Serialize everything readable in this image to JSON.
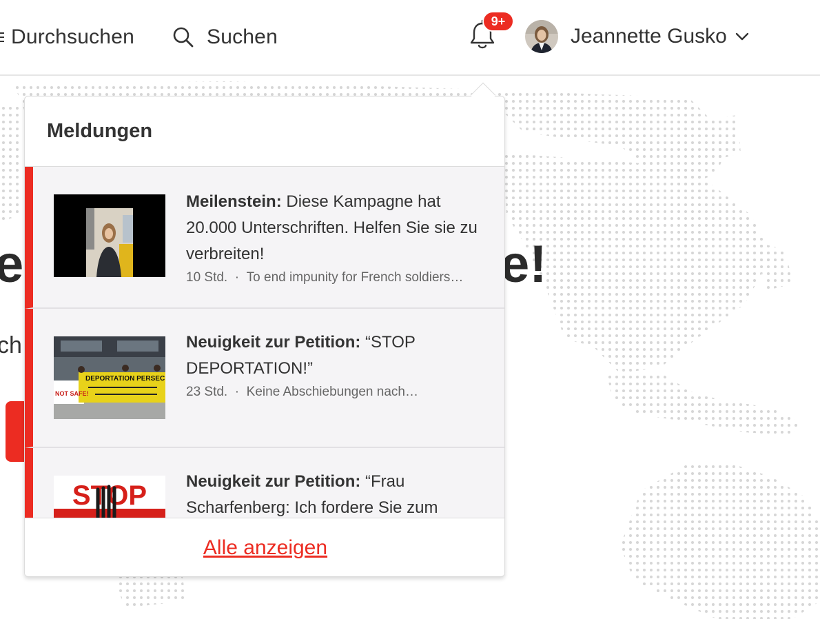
{
  "header": {
    "browse_label": "Durchsuchen",
    "search_label": "Suchen",
    "notification_badge": "9+",
    "user_name": "Jeannette Gusko"
  },
  "hero": {
    "left_fragment": "e",
    "right_fragment": "e!",
    "sub_fragment": "ch"
  },
  "notifications": {
    "title": "Meldungen",
    "items": [
      {
        "label": "Meilenstein:",
        "text": " Diese Kampagne hat 20.000 Unterschriften. Helfen Sie sie zu verbreiten!",
        "time": "10 Std.",
        "separator": "·",
        "context": "To end impunity for French soldiers…"
      },
      {
        "label": "Neuigkeit zur Petition:",
        "text": " “STOP DEPORTATION!”",
        "time": "23 Std.",
        "separator": "·",
        "context": "Keine Abschiebungen nach…"
      },
      {
        "label": "Neuigkeit zur Petition:",
        "text": " “Frau Scharfenberg: Ich fordere Sie zum",
        "time": "",
        "separator": "",
        "context": ""
      }
    ],
    "footer_link": "Alle anzeigen"
  },
  "thumbnails": {
    "protest_banner_text": "DEPORTATION PERSEC",
    "stop_text": "STOP",
    "banner_side_text": "NOT SAFE!"
  },
  "colors": {
    "accent": "#ec2c22",
    "text": "#333333",
    "muted": "#666666",
    "item_bg": "#f5f4f6"
  }
}
